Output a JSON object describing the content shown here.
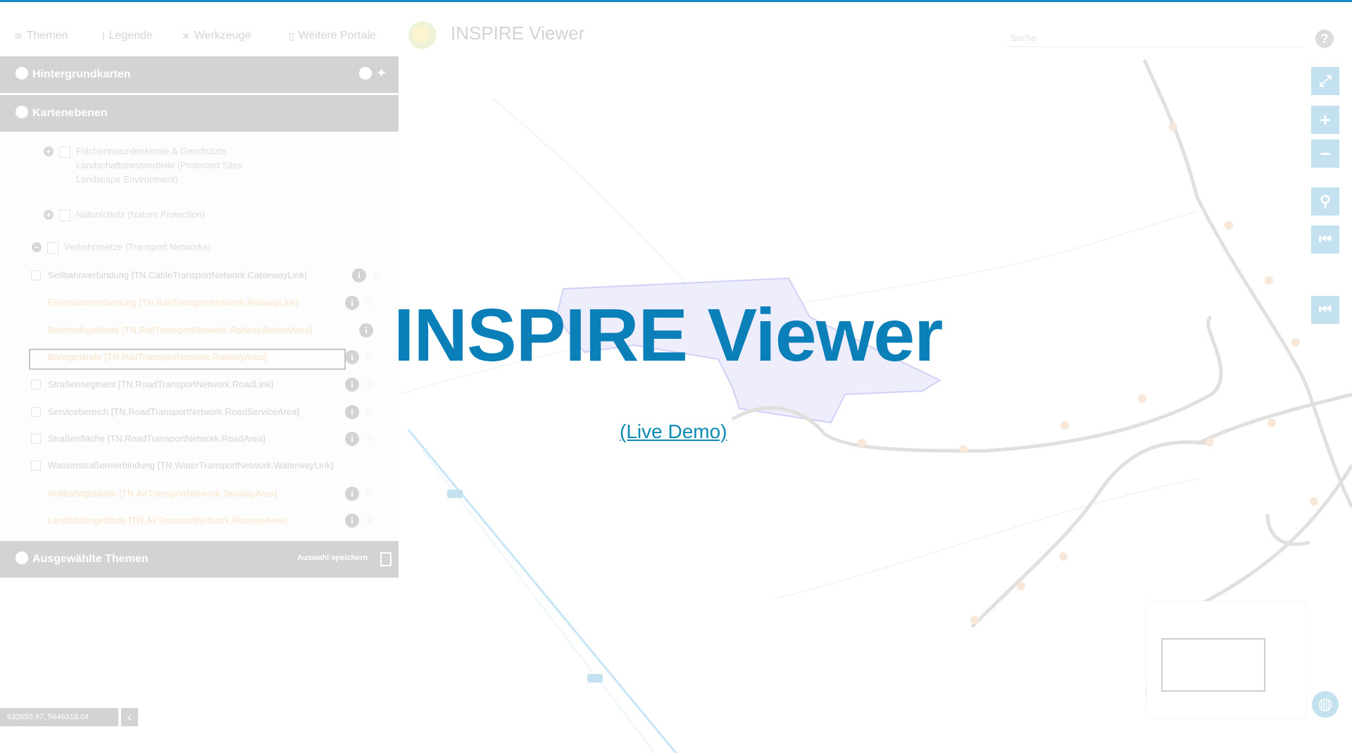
{
  "colors": {
    "accent": "#1a8ac6",
    "title": "#0a7fb8",
    "link": "#0a8ab3",
    "line": "#8a8580",
    "node": "#e8a86a",
    "water": "#22a0d8",
    "area": "#4d4de0"
  },
  "menu": {
    "items": [
      {
        "label": "Themen",
        "icon": "layers-icon"
      },
      {
        "label": "Legende",
        "icon": "legend-icon"
      },
      {
        "label": "Werkzeuge",
        "icon": "tools-icon"
      },
      {
        "label": "Weitere Portale",
        "icon": "portal-icon"
      }
    ],
    "app_title": "INSPIRE Viewer",
    "search_label": "Suche"
  },
  "panel": {
    "basemaps": "Hintergrundkarten",
    "layers": "Kartenebenen",
    "groups": [
      {
        "label": "Flächennaturdenkmale & Geschützte Landschaftsbestandteile (Protected Sites Landscape Environment)"
      },
      {
        "label": "Naturschutz (Nature Protection)"
      },
      {
        "label": "Verkehrsnetze (Transport Networks)"
      }
    ],
    "layer_items": [
      {
        "label": "Seilbahnverbindung [TN.CableTransportNetwork.CablewayLink]",
        "style": "grey"
      },
      {
        "label": "Eisenbahnverbindung [TN.RailTransportNetwork.RailwayLink]",
        "style": "orange"
      },
      {
        "label": "Bahnhofsgelände [TN.RailTransportNetwork.RailwayStationArea]",
        "style": "orange"
      },
      {
        "label": "Bahngelände [TN.RailTransportNetwork.RailwayArea]",
        "style": "orange"
      },
      {
        "label": "Straßensegment [TN.RoadTransportNetwork.RoadLink]",
        "style": "grey"
      },
      {
        "label": "Servicebereich [TN.RoadTransportNetwork.RoadServiceArea]",
        "style": "grey"
      },
      {
        "label": "Straßenfläche [TN.RoadTransportNetwork.RoadArea]",
        "style": "grey"
      },
      {
        "label": "Wasserstraßenverbindung [TN.WaterTransportNetwork.WaterwayLink]",
        "style": "grey"
      },
      {
        "label": "Rollbahngelände [TN.AirTransportNetwork.TaxiwayArea]",
        "style": "orange"
      },
      {
        "label": "Landebahngelände [TN.AirTransportNetwork.RunwayArea]",
        "style": "orange"
      }
    ],
    "selected_themes": "Ausgewählte Themen",
    "save_selection": "Auswahl speichern"
  },
  "coordinates": "632650.97, 5646318.04",
  "overlay": {
    "title": "INSPIRE Viewer",
    "link": "(Live Demo)"
  }
}
